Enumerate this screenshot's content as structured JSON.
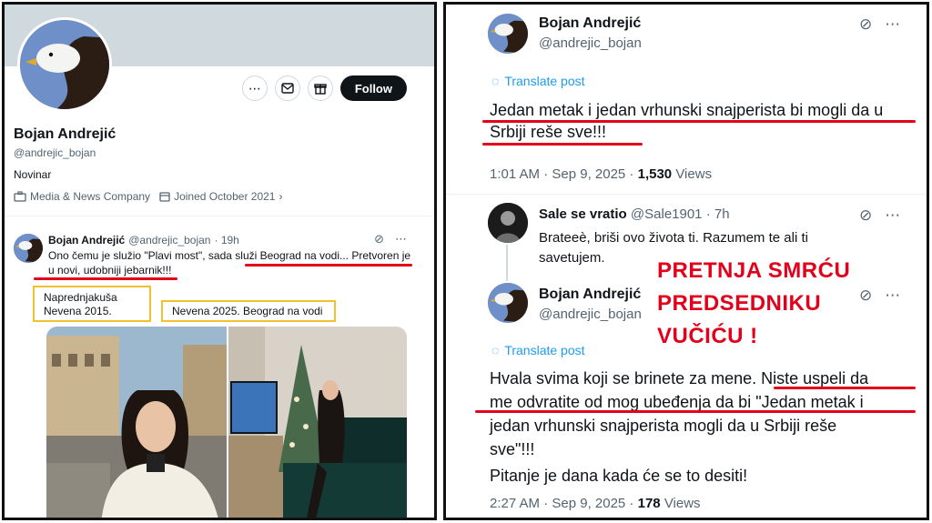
{
  "left": {
    "profile": {
      "name": "Bojan Andrejić",
      "handle": "@andrejic_bojan",
      "bio": "Novinar",
      "category": "Media & News Company",
      "joined": "Joined October 2021",
      "follow_label": "Follow",
      "more_icon": "more-horizontal-icon",
      "message_icon": "envelope-icon",
      "subscribe_icon": "gift-icon"
    },
    "tweet": {
      "name": "Bojan Andrejić",
      "handle": "@andrejic_bojan",
      "time": "· 19h",
      "text": "Ono čemu je služio \"Plavi most\", sada služi Beograd na vodi... Pretvoren je u novi, udobniji jebarnik!!!"
    },
    "box1": "Naprednjakuša Nevena 2015.",
    "box2": "Nevena 2025. Beograd na vodi"
  },
  "right": {
    "tweet1": {
      "name": "Bojan Andrejić",
      "handle": "@andrejic_bojan",
      "translate": "Translate post",
      "text": "Jedan metak i jedan vrhunski snajperista bi mogli da u Srbiji reše sve!!!",
      "time": "1:01 AM · Sep 9, 2025 ·",
      "views_count": "1,530",
      "views_label": "Views"
    },
    "reply": {
      "name": "Sale se vratio",
      "handle": "@Sale1901 · 7h",
      "text": "Brateeè, briši ovo života ti. Razumem te ali ti savetujem."
    },
    "tweet2": {
      "name": "Bojan Andrejić",
      "handle": "@andrejic_bojan",
      "translate": "Translate post",
      "text": "Hvala svima koji se brinete za mene. Niste uspeli da me odvratite od mog ubeđenja da bi  \"Jedan metak i jedan vrhunski snajperista mogli da u Srbiji reše sve\"!!!",
      "text2": "Pitanje je dana kada će se to desiti!",
      "time": "2:27 AM · Sep 9, 2025 ·",
      "views_count": "178",
      "views_label": "Views"
    },
    "overlay_lines": [
      "PRETNJA SMRĆU",
      "PREDSEDNIKU",
      "VUČIĆU !"
    ]
  },
  "colors": {
    "accent_red": "#e3001b",
    "box_yellow": "#f2c12e",
    "link_blue": "#1d9bf0"
  }
}
